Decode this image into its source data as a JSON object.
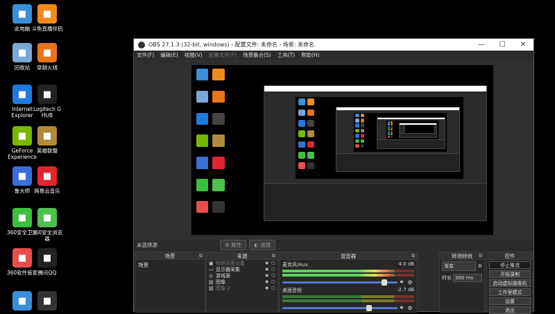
{
  "desktop": {
    "icons": [
      {
        "label": "此电脑",
        "icon": "computer-icon",
        "color": "#3a8fd8"
      },
      {
        "label": "斗鱼直播伴侣",
        "icon": "douyu-icon",
        "color": "#f08a1c"
      },
      {
        "label": "回收站",
        "icon": "recycle-bin-icon",
        "color": "#7aa7d6"
      },
      {
        "label": "穿越火线",
        "icon": "crossfire-icon",
        "color": "#e8731c"
      },
      {
        "label": "Internet Explorer",
        "icon": "ie-icon",
        "color": "#1f7ae0"
      },
      {
        "label": "Logitech G HUB",
        "icon": "logitech-icon",
        "color": "#222222"
      },
      {
        "label": "GeForce Experience",
        "icon": "geforce-icon",
        "color": "#76b900"
      },
      {
        "label": "英雄联盟",
        "icon": "lol-icon",
        "color": "#b08a3c"
      },
      {
        "label": "鲁大师",
        "icon": "ludashi-icon",
        "color": "#3c6fd6"
      },
      {
        "label": "网易云音乐",
        "icon": "netease-music-icon",
        "color": "#e0262e"
      },
      {
        "label": "360安全卫士",
        "icon": "360-safe-icon",
        "color": "#3cbf3c"
      },
      {
        "label": "360安全浏览器",
        "icon": "360-browser-icon",
        "color": "#4ec04e"
      },
      {
        "label": "360软件管家",
        "icon": "360-soft-icon",
        "color": "#e94e4e"
      },
      {
        "label": "腾讯QQ",
        "icon": "qq-icon",
        "color": "#222222"
      },
      {
        "label": "",
        "icon": "monitor-icon",
        "color": "#3a8fd8"
      },
      {
        "label": "",
        "icon": "obs-icon",
        "color": "#333333"
      }
    ]
  },
  "obs": {
    "title": "OBS 27.1.3 (32-bit, windows) - 配置文件: 未命名 - 场景: 未命名",
    "window_controls": {
      "minimize": "—",
      "maximize": "☐",
      "close": "✕"
    },
    "menu": [
      {
        "label": "文件(F)",
        "enabled": true
      },
      {
        "label": "编辑(E)",
        "enabled": true
      },
      {
        "label": "视图(V)",
        "enabled": true
      },
      {
        "label": "配置文件(P)",
        "enabled": false
      },
      {
        "label": "场景集合(S)",
        "enabled": true
      },
      {
        "label": "工具(T)",
        "enabled": true
      },
      {
        "label": "帮助(H)",
        "enabled": true
      }
    ],
    "source_bar": {
      "no_source": "未选择源",
      "properties": "属性",
      "filters": "滤镜"
    },
    "scenes": {
      "header": "场景",
      "items": [
        "场景"
      ]
    },
    "sources": {
      "header": "来源",
      "items": [
        {
          "name": "视频采集设备",
          "enabled": false
        },
        {
          "name": "显示器采集",
          "enabled": true
        },
        {
          "name": "游戏源",
          "enabled": true
        },
        {
          "name": "图像",
          "enabled": true
        },
        {
          "name": "图像 2",
          "enabled": false
        }
      ]
    },
    "mixer": {
      "header": "混音器",
      "channels": [
        {
          "name": "麦克风/Aux",
          "db": "4.0 dB",
          "level": 0.82,
          "volume": 0.9
        },
        {
          "name": "桌面音频",
          "db": "-2.7 dB",
          "level": 0.0,
          "volume": 0.77
        }
      ]
    },
    "transitions": {
      "header": "转场特效",
      "type": "渐变",
      "duration_label": "时长",
      "duration_value": "300 ms"
    },
    "controls": {
      "header": "控件",
      "buttons": [
        "停止推流",
        "开始录制",
        "启动虚拟摄像机",
        "工作室模式",
        "设置",
        "退出"
      ]
    }
  }
}
